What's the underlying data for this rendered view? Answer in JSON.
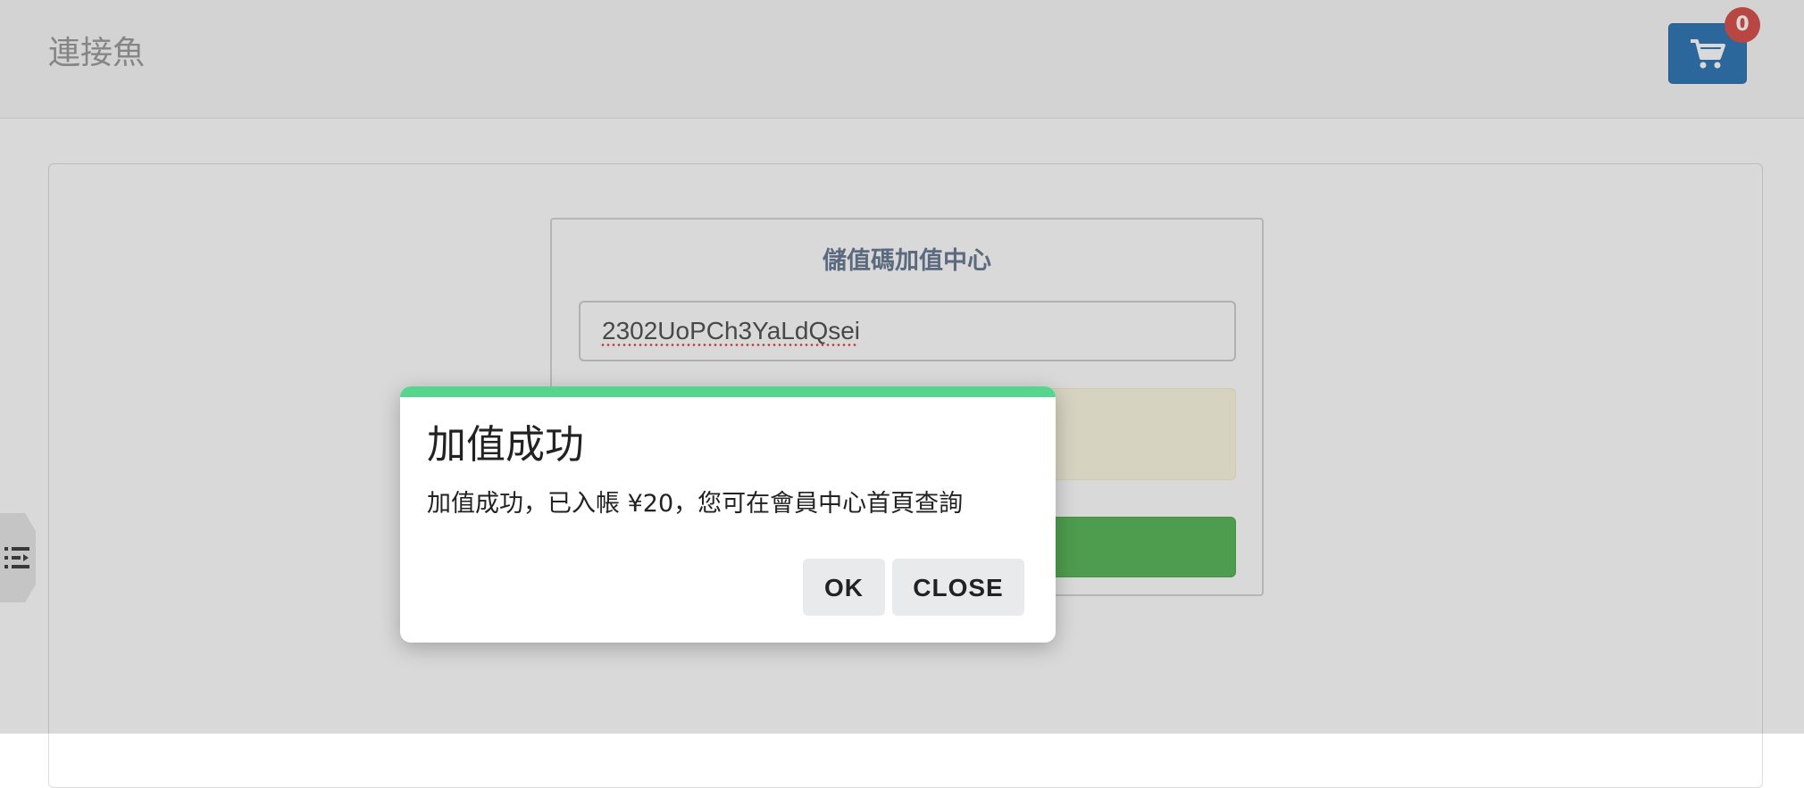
{
  "navbar": {
    "brand": "連接魚",
    "cart": {
      "icon": "shopping-cart-icon",
      "count": "0",
      "button_color": "#337ab7",
      "badge_color": "#d9534f"
    }
  },
  "topup": {
    "title": "儲值碼加值中心",
    "code_value": "2302UoPCh3YaLdQsei",
    "submit_color": "#5cb85c",
    "notice_color": "#fcf8e3"
  },
  "side_toggle": {
    "icon": "list-toggle-icon"
  },
  "dialog": {
    "accent_color": "#56d68c",
    "title": "加值成功",
    "message": "加值成功，已入帳 ¥20，您可在會員中心首頁查詢",
    "ok_label": "OK",
    "close_label": "CLOSE"
  }
}
